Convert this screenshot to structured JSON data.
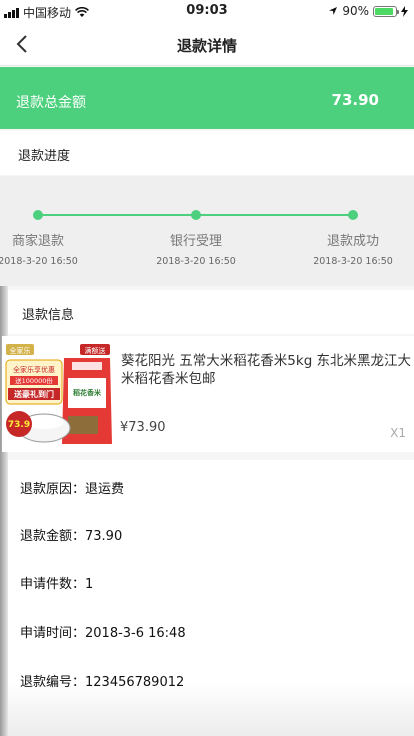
{
  "status_bar": {
    "carrier": "中国移动",
    "time": "09:03",
    "battery": "90%",
    "battery_level": 0.9
  },
  "nav": {
    "title": "退款详情"
  },
  "summary": {
    "total_label": "退款总金额",
    "total_amount": "73.90"
  },
  "progress": {
    "title": "退款进度",
    "steps": [
      {
        "label": "商家退款",
        "time": "2018-3-20 16:50"
      },
      {
        "label": "银行受理",
        "time": "2018-3-20 16:50"
      },
      {
        "label": "退款成功",
        "time": "2018-3-20 16:50"
      }
    ]
  },
  "refund_info": {
    "title": "退款信息",
    "product": {
      "name": "葵花阳光 五常大米稻花香米5kg 东北米黑龙江大米稻花香米包邮",
      "price": "¥73.90",
      "quantity": "X1",
      "image_text": {
        "badge_left": "全家乐",
        "badge_right": "满额送",
        "line1": "全家乐享优惠",
        "line2": "送100000份",
        "line3": "送豪礼到门",
        "price": "73.9",
        "bag": "稻花香米"
      }
    },
    "details": [
      "退款原因：退运费",
      "退款金额：73.90",
      "申请件数：1",
      "申请时间：2018-3-6 16:48",
      "退款编号：123456789012"
    ]
  },
  "colors": {
    "accent": "#4cd07d",
    "background": "#efefef"
  }
}
